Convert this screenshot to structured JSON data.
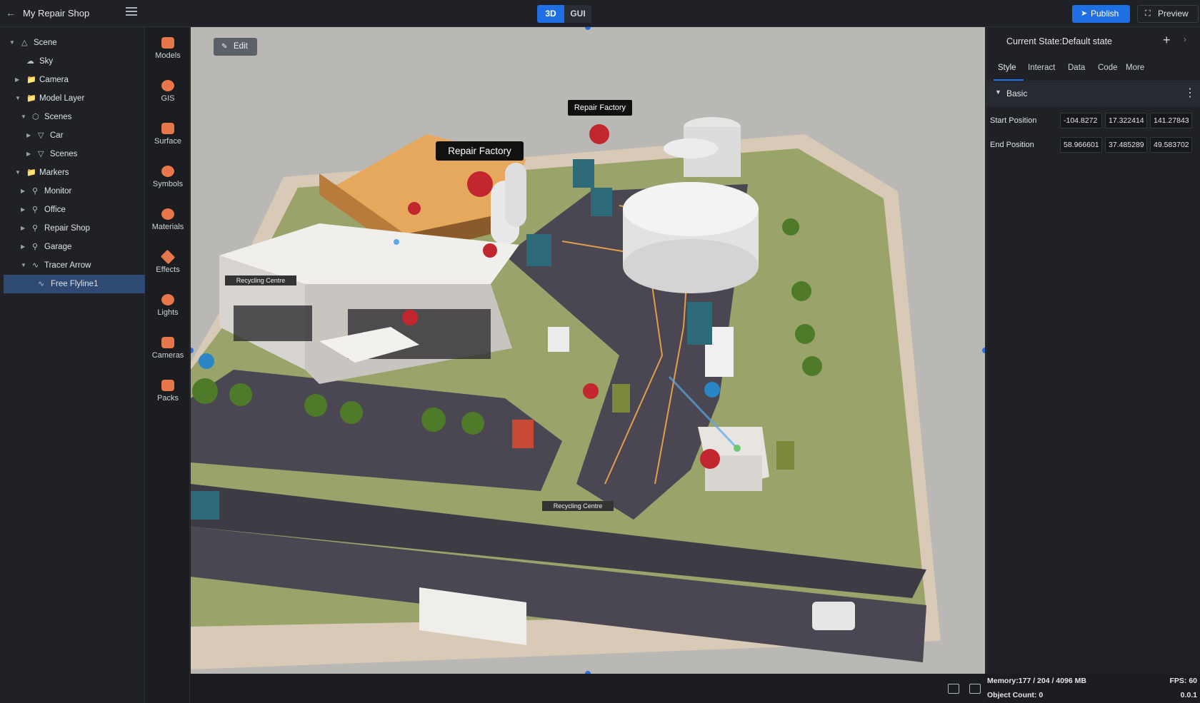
{
  "app": {
    "title": "My Repair Shop"
  },
  "mode_toggle": {
    "options": [
      "3D",
      "GUI"
    ],
    "selected": "3D"
  },
  "actions": {
    "publish": "Publish",
    "preview": "Preview"
  },
  "tree": [
    {
      "label": "Scene",
      "icon": "scene-icon",
      "expanded": true
    },
    {
      "label": "Sky",
      "icon": "sky-icon"
    },
    {
      "label": "Camera",
      "icon": "folder-icon",
      "expanded": false
    },
    {
      "label": "Model Layer",
      "icon": "folder-icon",
      "expanded": true
    },
    {
      "label": "Scenes",
      "icon": "cube-icon",
      "expanded": true
    },
    {
      "label": "Car",
      "icon": "mesh-icon",
      "expanded": false
    },
    {
      "label": "Scenes",
      "icon": "mesh-icon",
      "expanded": false
    },
    {
      "label": "Markers",
      "icon": "folder-icon",
      "expanded": true
    },
    {
      "label": "Monitor",
      "icon": "marker-icon",
      "expanded": false
    },
    {
      "label": "Office",
      "icon": "marker-icon",
      "expanded": false
    },
    {
      "label": "Repair Shop",
      "icon": "marker-icon",
      "expanded": false
    },
    {
      "label": "Garage",
      "icon": "marker-icon",
      "expanded": false
    },
    {
      "label": "Tracer Arrow",
      "icon": "flyline-icon",
      "expanded": true
    },
    {
      "label": "Free Flyline1",
      "icon": "flyline-icon",
      "selected": true
    }
  ],
  "toolbox": [
    "Models",
    "GIS",
    "Surface",
    "Symbols",
    "Materials",
    "Effects",
    "Lights",
    "Cameras",
    "Packs"
  ],
  "viewport": {
    "edit_label": "Edit",
    "labels": {
      "big": "Repair Factory",
      "small": "Repair Factory",
      "sign1": "Recycling Centre",
      "sign2": "Recycling Centre"
    }
  },
  "inspector": {
    "state_title": "Current State:Default state",
    "tabs": [
      "Style",
      "Interact",
      "Data",
      "Code",
      "More"
    ],
    "active_tab": "Style",
    "section": "Basic",
    "start_position": {
      "label": "Start Position",
      "values": [
        "-104.8272",
        "17.322414",
        "141.27843"
      ]
    },
    "end_position": {
      "label": "End Position",
      "values": [
        "58.966601",
        "37.485289",
        "49.583702"
      ]
    }
  },
  "metrics": {
    "memory": "Memory:177 / 204 / 4096 MB",
    "objects": "Object Count: 0",
    "fps": "FPS: 60",
    "version": "0.0.1"
  },
  "colors": {
    "accent": "#1f6fe5",
    "selected_row": "#2e4a73",
    "tool_icon": "#e7764a"
  }
}
